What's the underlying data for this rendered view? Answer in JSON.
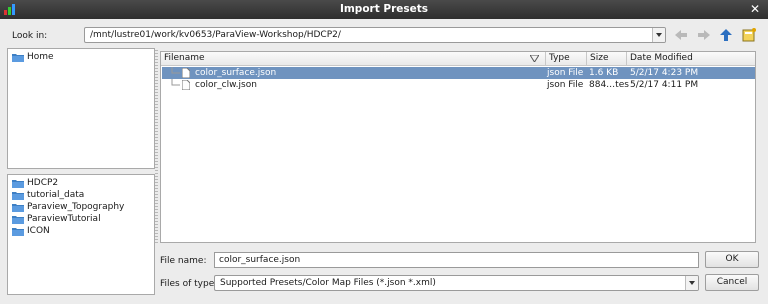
{
  "window": {
    "title": "Import Presets",
    "close_glyph": "✕"
  },
  "look_in": {
    "label": "Look in:",
    "path": "/mnt/lustre01/work/kv0653/ParaView-Workshop/HDCP2/"
  },
  "nav": {
    "back_icon": "back-arrow-icon",
    "forward_icon": "forward-arrow-icon",
    "up_icon": "up-arrow-icon",
    "new_folder_icon": "new-folder-icon"
  },
  "places": [
    {
      "label": "Home"
    }
  ],
  "recent": [
    {
      "label": "HDCP2"
    },
    {
      "label": "tutorial_data"
    },
    {
      "label": "Paraview_Topography"
    },
    {
      "label": "ParaviewTutorial"
    },
    {
      "label": "ICON"
    }
  ],
  "columns": {
    "filename": "Filename",
    "type": "Type",
    "size": "Size",
    "date": "Date Modified"
  },
  "files": [
    {
      "name": "color_surface.json",
      "type": "json File",
      "size": "1.6 KB",
      "date": "5/2/17 4:23 PM",
      "selected": true
    },
    {
      "name": "color_clw.json",
      "type": "json File",
      "size": "884…tes",
      "date": "5/2/17 4:11 PM",
      "selected": false
    }
  ],
  "file_name": {
    "label": "File name:",
    "value": "color_surface.json"
  },
  "file_type": {
    "label": "Files of type:",
    "value": "Supported Presets/Color Map Files (*.json *.xml)"
  },
  "buttons": {
    "ok": "OK",
    "cancel": "Cancel"
  },
  "colors": {
    "selection": "#6f93bf",
    "titlebar": "#3a3a3a",
    "folder": "#3d7fc4"
  }
}
